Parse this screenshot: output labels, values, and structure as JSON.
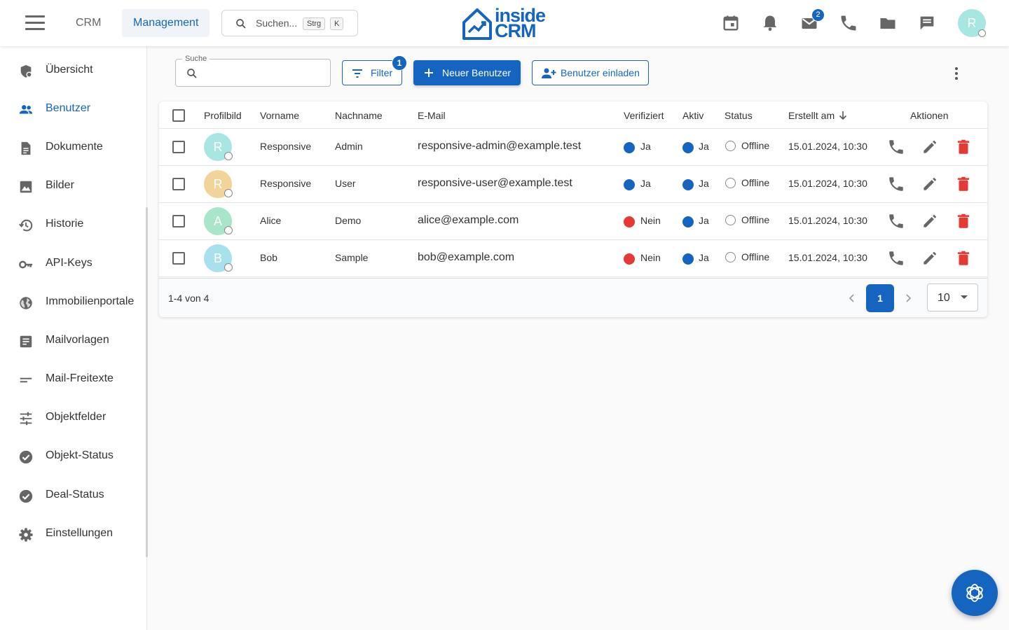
{
  "topbar": {
    "nav": [
      {
        "label": "CRM",
        "active": false
      },
      {
        "label": "Management",
        "active": true
      }
    ],
    "search": {
      "placeholder": "Suchen...",
      "shortcut_1": "Strg",
      "shortcut_2": "K"
    },
    "logo": {
      "line_1": "inside",
      "line_2": "CRM"
    },
    "icons": [
      "calendar-icon",
      "bell-icon",
      "mail-icon",
      "phone-icon",
      "folder-icon",
      "chat-icon"
    ],
    "mail_badge": "2",
    "avatar_initial": "R"
  },
  "sidebar": {
    "items": [
      {
        "label": "Übersicht",
        "icon": "dashboard-icon"
      },
      {
        "label": "Benutzer",
        "icon": "users-icon",
        "active": true
      },
      {
        "label": "Dokumente",
        "icon": "document-icon"
      },
      {
        "label": "Bilder",
        "icon": "image-icon"
      },
      {
        "label": "Historie",
        "icon": "history-icon"
      },
      {
        "label": "API-Keys",
        "icon": "key-icon"
      },
      {
        "label": "Immobilienportale",
        "icon": "globe-icon"
      },
      {
        "label": "Mailvorlagen",
        "icon": "template-icon"
      },
      {
        "label": "Mail-Freitexte",
        "icon": "short-text-icon"
      },
      {
        "label": "Objektfelder",
        "icon": "tune-icon"
      },
      {
        "label": "Objekt-Status",
        "icon": "check-circle-icon"
      },
      {
        "label": "Deal-Status",
        "icon": "check-circle-icon"
      },
      {
        "label": "Einstellungen",
        "icon": "gear-icon"
      }
    ]
  },
  "toolbar": {
    "search_label": "Suche",
    "search_value": "",
    "filter_label": "Filter",
    "filter_count": "1",
    "new_user_label": "Neuer Benutzer",
    "invite_label": "Benutzer einladen"
  },
  "table": {
    "headers": {
      "avatar": "Profilbild",
      "first_name": "Vorname",
      "last_name": "Nachname",
      "email": "E-Mail",
      "verified": "Verifiziert",
      "active": "Aktiv",
      "status": "Status",
      "created": "Erstellt am",
      "actions": "Aktionen"
    },
    "rows": [
      {
        "initial": "R",
        "avatar_color": "#a8e6e3",
        "first": "Responsive",
        "last": "Admin",
        "email": "responsive-admin@example.test",
        "verified": "Ja",
        "verified_color": "#1565c0",
        "active": "Ja",
        "active_color": "#1565c0",
        "status": "Offline",
        "created": "15.01.2024, 10:30"
      },
      {
        "initial": "R",
        "avatar_color": "#f2d49b",
        "first": "Responsive",
        "last": "User",
        "email": "responsive-user@example.test",
        "verified": "Ja",
        "verified_color": "#1565c0",
        "active": "Ja",
        "active_color": "#1565c0",
        "status": "Offline",
        "created": "15.01.2024, 10:30"
      },
      {
        "initial": "A",
        "avatar_color": "#a8e6c9",
        "first": "Alice",
        "last": "Demo",
        "email": "alice@example.com",
        "verified": "Nein",
        "verified_color": "#e53935",
        "active": "Ja",
        "active_color": "#1565c0",
        "status": "Offline",
        "created": "15.01.2024, 10:30"
      },
      {
        "initial": "B",
        "avatar_color": "#a8e0ee",
        "first": "Bob",
        "last": "Sample",
        "email": "bob@example.com",
        "verified": "Nein",
        "verified_color": "#e53935",
        "active": "Ja",
        "active_color": "#1565c0",
        "status": "Offline",
        "created": "15.01.2024, 10:30"
      }
    ],
    "footer": {
      "range": "1-4 von 4",
      "current_page": "1",
      "per_page": "10"
    }
  },
  "colors": {
    "accent": "#1565c0",
    "danger": "#e53935"
  }
}
